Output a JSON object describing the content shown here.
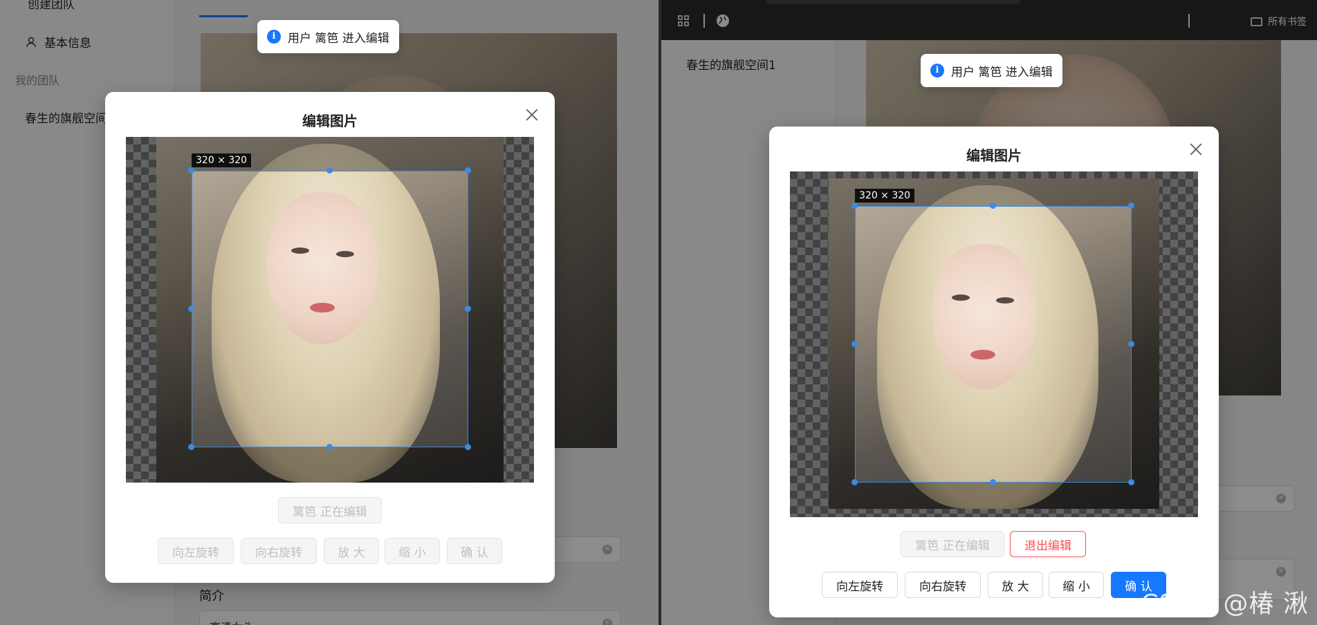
{
  "left": {
    "sidebar": {
      "top_item": "创建团队",
      "basic_info": "基本信息",
      "my_team_header": "我的团队",
      "team_item": "春生的旗舰空间"
    },
    "bottom_label": "简介",
    "bottom_value": "高清女头"
  },
  "right": {
    "sidebar": {
      "team_item": "春生的旗舰空间1"
    },
    "browser": {
      "bookmarks": "所有书签"
    }
  },
  "toast": {
    "icon": "info-icon",
    "message": "用户 篱笆 进入编辑"
  },
  "modal": {
    "title": "编辑图片",
    "crop_size_label": "320 × 320",
    "status_button": "篱笆 正在编辑",
    "exit_button": "退出编辑",
    "rotate_left": "向左旋转",
    "rotate_right": "向右旋转",
    "zoom_in": "放 大",
    "zoom_out": "缩 小",
    "confirm": "确 认"
  },
  "watermark": "CSDN @椿 湫",
  "colors": {
    "primary": "#1677ff",
    "danger": "#ff4d4f",
    "crop_border": "#3b8be0"
  }
}
